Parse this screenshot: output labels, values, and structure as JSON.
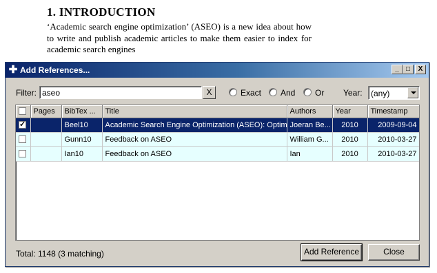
{
  "document": {
    "heading": "1.  INTRODUCTION",
    "paragraph": "‘Academic search engine optimization’ (ASEO) is a new idea about how to write and publish academic articles to make them easier to index for academic search engines"
  },
  "dialog": {
    "title": "Add References...",
    "title_icon": "plus-icon",
    "window_controls": {
      "minimize": "_",
      "maximize": "□",
      "close": "X"
    },
    "filter": {
      "label": "Filter:",
      "value": "aseo",
      "clear_label": "X"
    },
    "match_mode": {
      "options": [
        {
          "label": "Exact",
          "checked": false
        },
        {
          "label": "And",
          "checked": true
        },
        {
          "label": "Or",
          "checked": false
        }
      ]
    },
    "year": {
      "label": "Year:",
      "selected": "(any)"
    },
    "table": {
      "columns": [
        "",
        "Pages",
        "BibTex ...",
        "Title",
        "Authors",
        "Year",
        "Timestamp"
      ],
      "rows": [
        {
          "checked": true,
          "selected": true,
          "pages": "",
          "bibtex": "Beel10",
          "title": "Academic Search Engine Optimization (ASEO): Optim...",
          "authors": "Joeran Be...",
          "year": "2010",
          "timestamp": "2009-09-04"
        },
        {
          "checked": false,
          "selected": false,
          "pages": "",
          "bibtex": "Gunn10",
          "title": "Feedback on ASEO",
          "authors": "William G...",
          "year": "2010",
          "timestamp": "2010-03-27"
        },
        {
          "checked": false,
          "selected": false,
          "pages": "",
          "bibtex": "Ian10",
          "title": "Feedback on ASEO",
          "authors": "Ian",
          "year": "2010",
          "timestamp": "2010-03-27"
        }
      ]
    },
    "status": "Total: 1148 (3 matching)",
    "buttons": {
      "add": "Add Reference",
      "close": "Close"
    },
    "colors": {
      "selection": "#0a246a",
      "row_background": "#e6ffff",
      "titlebar": "#0a246a"
    }
  }
}
